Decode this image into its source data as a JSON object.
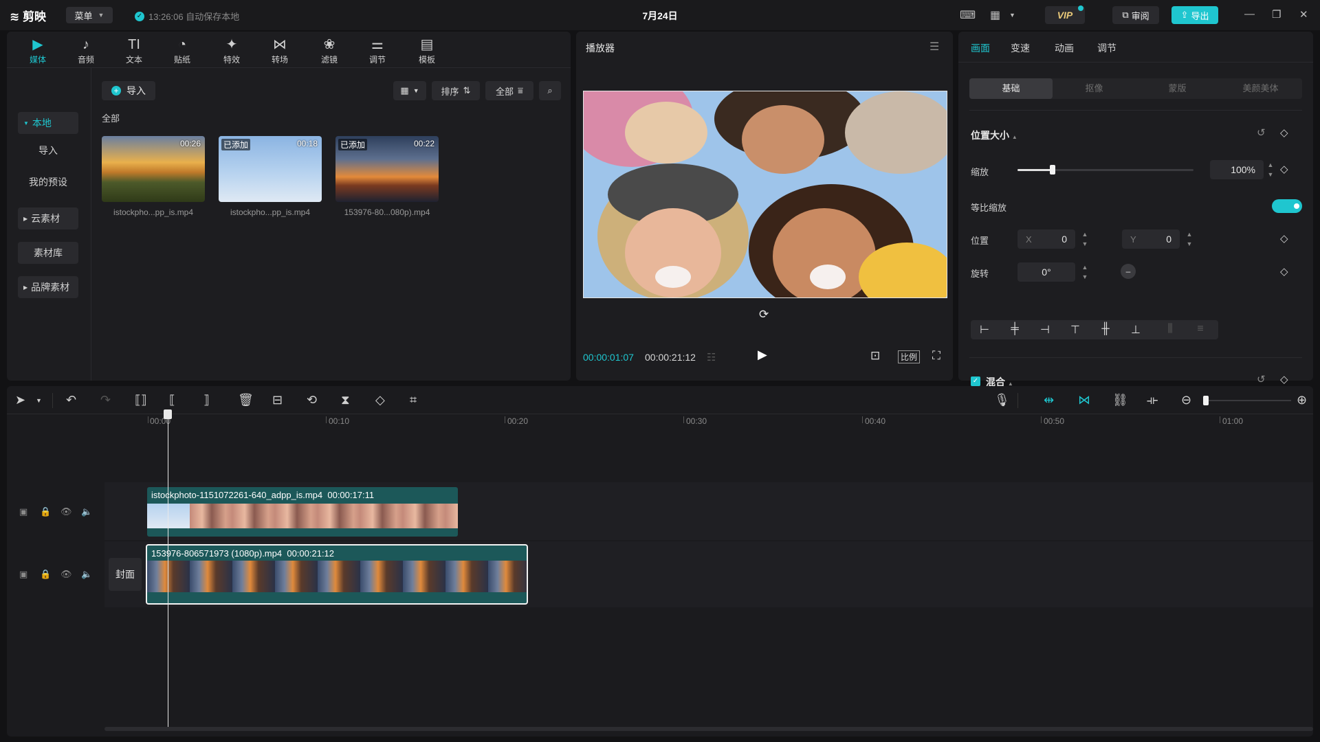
{
  "app": {
    "logo": "剪映",
    "menu_label": "菜单",
    "autosave_text": "13:26:06 自动保存本地",
    "project_title": "7月24日",
    "vip_label": "VIP",
    "review_label": "审阅",
    "export_label": "导出",
    "accent_color": "#1fc6cf"
  },
  "media": {
    "tools": [
      {
        "label": "媒体",
        "icon": "media-icon"
      },
      {
        "label": "音频",
        "icon": "audio-icon"
      },
      {
        "label": "文本",
        "icon": "text-icon"
      },
      {
        "label": "贴纸",
        "icon": "sticker-icon"
      },
      {
        "label": "特效",
        "icon": "effects-icon"
      },
      {
        "label": "转场",
        "icon": "transition-icon"
      },
      {
        "label": "滤镜",
        "icon": "filter-icon"
      },
      {
        "label": "调节",
        "icon": "adjust-icon"
      },
      {
        "label": "模板",
        "icon": "template-icon"
      }
    ],
    "sidebar": [
      "本地",
      "导入",
      "我的预设",
      "云素材",
      "素材库",
      "品牌素材"
    ],
    "import_label": "导入",
    "sort_label": "排序",
    "filter_label": "全部",
    "section_label": "全部",
    "added_label": "已添加",
    "items": [
      {
        "name": "istockpho...pp_is.mp4",
        "duration": "00:26",
        "added": false
      },
      {
        "name": "istockpho...pp_is.mp4",
        "duration": "00:18",
        "added": true
      },
      {
        "name": "153976-80...080p).mp4",
        "duration": "00:22",
        "added": true
      }
    ]
  },
  "player": {
    "title": "播放器",
    "current_time": "00:00:01:07",
    "total_time": "00:00:21:12",
    "ratio_label": "比例"
  },
  "properties": {
    "tabs": [
      "画面",
      "变速",
      "动画",
      "调节"
    ],
    "subtabs": [
      "基础",
      "抠像",
      "蒙版",
      "美颜美体"
    ],
    "section_position": "位置大小",
    "scale_label": "缩放",
    "scale_value": "100%",
    "scale_fraction": 0.2,
    "uniform_scale_label": "等比缩放",
    "uniform_scale_on": true,
    "position_label": "位置",
    "pos_x_axis": "X",
    "pos_x": "0",
    "pos_y_axis": "Y",
    "pos_y": "0",
    "rotation_label": "旋转",
    "rotation_value": "0°",
    "section_blend": "混合"
  },
  "timeline": {
    "ruler": [
      "00:00",
      "00:10",
      "00:20",
      "00:30",
      "00:40",
      "00:50",
      "01:00"
    ],
    "clip1_name": "istockphoto-1151072261-640_adpp_is.mp4",
    "clip1_duration": "00:00:17:11",
    "clip2_name": "153976-806571973 (1080p).mp4",
    "clip2_duration": "00:00:21:12",
    "cover_label": "封面"
  }
}
